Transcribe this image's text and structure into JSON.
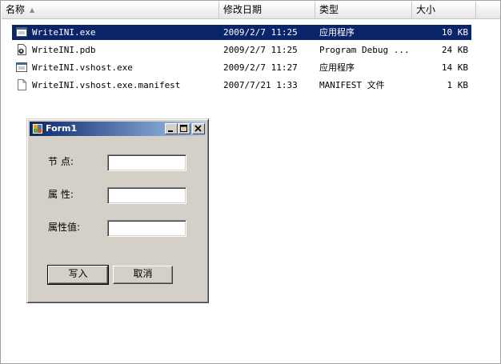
{
  "header": {
    "columns": [
      {
        "label": "名称"
      },
      {
        "label": "修改日期"
      },
      {
        "label": "类型"
      },
      {
        "label": "大小"
      }
    ],
    "sort_icon": "sort-ascending-icon"
  },
  "files": [
    {
      "name": "WriteINI.exe",
      "date": "2009/2/7 11:25",
      "type": "应用程序",
      "size": "10 KB",
      "icon": "exe-icon",
      "selected": true
    },
    {
      "name": "WriteINI.pdb",
      "date": "2009/2/7 11:25",
      "type": "Program Debug ...",
      "size": "24 KB",
      "icon": "pdb-icon",
      "selected": false
    },
    {
      "name": "WriteINI.vshost.exe",
      "date": "2009/2/7 11:27",
      "type": "应用程序",
      "size": "14 KB",
      "icon": "exe-icon",
      "selected": false
    },
    {
      "name": "WriteINI.vshost.exe.manifest",
      "date": "2007/7/21 1:33",
      "type": "MANIFEST 文件",
      "size": "1 KB",
      "icon": "file-icon",
      "selected": false
    }
  ],
  "form": {
    "title": "Form1",
    "node_label": "节  点:",
    "property_label": "属  性:",
    "value_label": "属性值:",
    "node_value": "",
    "property_value": "",
    "value_value": "",
    "write_button": "写入",
    "cancel_button": "取消"
  },
  "colors": {
    "selection": "#0a246a",
    "window_face": "#d4d0c8",
    "titlebar_start": "#0a246a",
    "titlebar_end": "#a6caf0"
  }
}
